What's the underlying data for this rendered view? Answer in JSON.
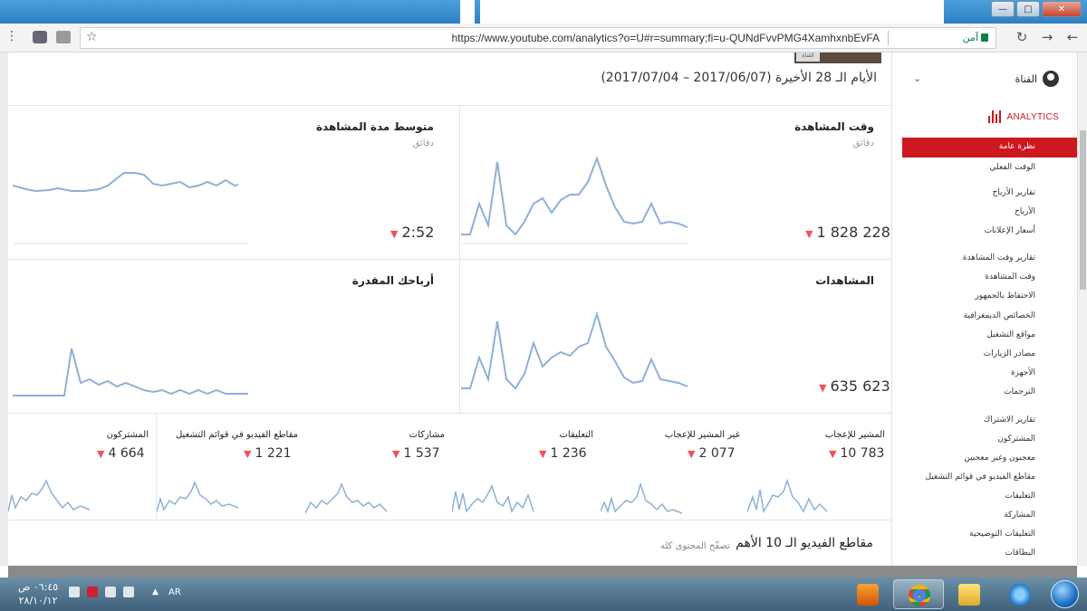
{
  "browser": {
    "url": "https://www.youtube.com/analytics?o=U#r=summary;fi=u-QUNdFvvPMG4XamhxnbEvFA",
    "security_label": "آمن",
    "window_buttons": {
      "minimize": "—",
      "maximize": "□",
      "close": "✕"
    }
  },
  "page": {
    "date_range": "الأيام الـ 28 الأخيرة (2017/06/07 – 2017/07/04)",
    "thumb_label": "القناة",
    "top_videos_title": "مقاطع الفيديو الـ 10 الأهم",
    "browse_all": "تصفّح المحتوى كله"
  },
  "cards": {
    "watch_time": {
      "title": "وقت المشاهدة",
      "unit": "دقائق",
      "value": "1 828 228"
    },
    "avg_duration": {
      "title": "متوسط مدة المشاهدة",
      "unit": "دقائق",
      "value": "2:52"
    },
    "views": {
      "title": "المشاهدات",
      "value": "635 623"
    },
    "revenue": {
      "title": "أرباحك المقدرة",
      "value": ""
    },
    "likes": {
      "title": "المشير للإعجاب",
      "value": "10 783"
    },
    "dislikes": {
      "title": "غير المشير للإعجاب",
      "value": "2 077"
    },
    "comments": {
      "title": "التعليقات",
      "value": "1 236"
    },
    "shares": {
      "title": "مشاركات",
      "value": "1 537"
    },
    "playlists": {
      "title": "مقاطع الفيديو في قوائم التشغيل",
      "value": "1 221"
    },
    "subscribers": {
      "title": "المشتركون",
      "value": "4 664"
    }
  },
  "sidebar": {
    "channel_label": "القناة",
    "analytics_label": "ANALYTICS",
    "items": [
      "نظرة عامة",
      "الوقت الفعلي",
      "تقارير الأرباح",
      "الأرباح",
      "أسعار الإعلانات",
      "تقارير وقت المشاهدة",
      "وقت المشاهدة",
      "الاحتفاظ بالجمهور",
      "الخصائص الديمغرافية",
      "مواقع التشغيل",
      "مصادر الزيارات",
      "الأجهزة",
      "الترجمات",
      "تقارير الاشتراك",
      "المشتركون",
      "معجبون وغير معجبين",
      "مقاطع الفيديو في قوائم التشغيل",
      "التعليقات",
      "المشاركة",
      "التعليقات التوضيحية",
      "البطاقات"
    ]
  },
  "taskbar": {
    "time": "٠٦:٤٥ ص",
    "date": "٢٨/١٠/١٢",
    "lang": "AR"
  },
  "colors": {
    "accent": "#cc181e",
    "line": "#8eb0d8",
    "down_arrow": "#e55555"
  }
}
